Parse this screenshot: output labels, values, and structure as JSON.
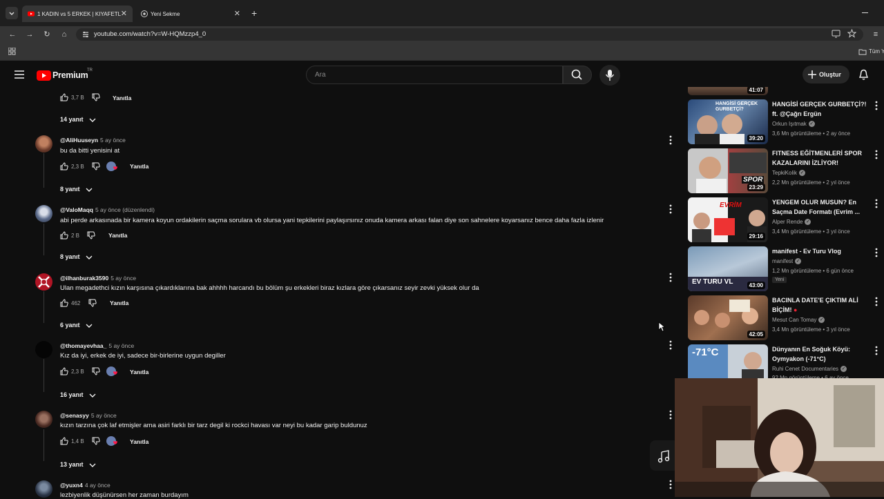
{
  "browser": {
    "tabs": [
      {
        "title": "1 KADIN vs 5 ERKEK | KIYAFETL",
        "active": true
      },
      {
        "title": "Yeni Sekme",
        "active": false
      }
    ],
    "url": "youtube.com/watch?v=W-HQMzzp4_0",
    "bookmarks_right": "Tüm Y"
  },
  "youtube": {
    "logo_text": "Premium",
    "logo_sup": "TR",
    "search_placeholder": "Ara",
    "create_label": "Oluştur"
  },
  "comments": {
    "top": {
      "likes": "3,7 B",
      "reply_label": "Yanıtla",
      "replies": "14 yanıt"
    },
    "items": [
      {
        "author": "@AliHuuseyn",
        "time": "5 ay önce",
        "text": "bu da bitti yenisini at",
        "likes": "2,3 B",
        "reply_label": "Yanıtla",
        "replies": "8 yanıt",
        "creator_heart": true
      },
      {
        "author": "@ValoMaqq",
        "time": "5 ay önce (düzenlendi)",
        "text": "abi perde arkasınada bir kamera koyun ordakilerin saçma sorulara vb olursa yani tepkilerini paylaşırsınız onuda kamera arkası falan diye son sahnelere koyarsanız bence daha fazla izlenir",
        "likes": "2 B",
        "reply_label": "Yanıtla",
        "replies": "8 yanıt",
        "creator_heart": false
      },
      {
        "author": "@ilhanburak3590",
        "time": "5 ay önce",
        "text": "Ulan megadethci kızın karşısına çıkardıklarına bak ahhhh harcandı bu bölüm şu erkekleri biraz kızlara göre çıkarsanız seyir zevki yüksek olur da",
        "likes": "462",
        "reply_label": "Yanıtla",
        "replies": "6 yanıt",
        "creator_heart": false
      },
      {
        "author": "@thomayevhaa_",
        "time": "5 ay önce",
        "text": "Kız da iyi, erkek de iyi, sadece bir-birlerine uygun degiller",
        "likes": "2,3 B",
        "reply_label": "Yanıtla",
        "replies": "16 yanıt",
        "creator_heart": true
      },
      {
        "author": "@senasyy",
        "time": "5 ay önce",
        "text": "kızın tarzına çok laf etmişler ama asiri farklı bir tarz degil ki rockci havası var neyi bu kadar garip buldunuz",
        "likes": "1,4 B",
        "reply_label": "Yanıtla",
        "replies": "13 yanıt",
        "creator_heart": true
      },
      {
        "author": "@yuxn4",
        "time": "4 ay önce",
        "text": "lezbiyenlik düşünürsen her zaman burdayım"
      }
    ]
  },
  "sidebar": {
    "top_duration": "41:07",
    "videos": [
      {
        "title": "HANGİSİ GERÇEK GURBETÇİ?! ft. @Çağrı Ergün",
        "channel": "Orkun Işıtmak",
        "meta": "3,6 Mn görüntüleme • 2 ay önce",
        "duration": "39:20",
        "thumb_text": "HANGİSİ GERÇEK GURBETÇİ?"
      },
      {
        "title": "FITNESS EĞİTMENLERİ SPOR KAZALARINI İZLİYOR!",
        "channel": "TepkiKolik",
        "meta": "2,2 Mn görüntüleme • 2 yıl önce",
        "duration": "23:29",
        "thumb_text": "SPOR"
      },
      {
        "title": "YENGEM OLUR MUSUN? En Saçma Date Formatı (Evrim ...",
        "channel": "Alper Rende",
        "meta": "3,4 Mn görüntüleme • 3 yıl önce",
        "duration": "29:16",
        "thumb_text": "EVRİM"
      },
      {
        "title": "manifest - Ev Turu Vlog",
        "channel": "manifest",
        "meta": "1,2 Mn görüntüleme • 6 gün önce",
        "duration": "43:00",
        "badge": "Yeni",
        "thumb_text": "EV TURU VL"
      },
      {
        "title": "BACINLA DATE'E ÇIKTIM ALİ BİÇİM!",
        "channel": "Mesut Can Tomay",
        "meta": "3,4 Mn görüntüleme • 3 yıl önce",
        "duration": "42:05",
        "thumb_text": ""
      },
      {
        "title": "Dünyanın En Soğuk Köyü: Oymyakon (-71°C)",
        "channel": "Ruhi Cenet Documentaries",
        "meta": "92 Mn görüntüleme • 6 ay önce",
        "duration": "",
        "thumb_text": "-71°C"
      }
    ]
  },
  "colors": {
    "yt_red": "#ff0000",
    "bg": "#0f0f0f",
    "chrome_bg": "#1f1f1f",
    "toolbar": "#353535"
  }
}
